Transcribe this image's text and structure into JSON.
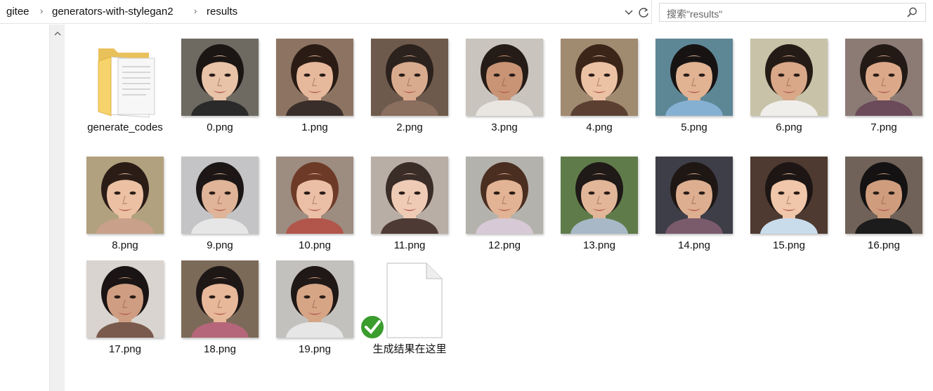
{
  "address_bar": {
    "crumbs": [
      "gitee",
      "generators-with-stylegan2",
      "results"
    ]
  },
  "search": {
    "placeholder": "搜索\"results\""
  },
  "files": [
    {
      "name": "generate_codes",
      "type": "folder"
    },
    {
      "name": "0.png",
      "type": "image",
      "bg": "#6e6a62",
      "skin": "#e8c3a8",
      "hair": "#1b1514",
      "cloth": "#2a2a2a"
    },
    {
      "name": "1.png",
      "type": "image",
      "bg": "#8d7462",
      "skin": "#e6b89c",
      "hair": "#2a1c15",
      "cloth": "#3a2e2a"
    },
    {
      "name": "2.png",
      "type": "image",
      "bg": "#6e5a4c",
      "skin": "#d9ab8e",
      "hair": "#2c221d",
      "cloth": "#8a6e5e"
    },
    {
      "name": "3.png",
      "type": "image",
      "bg": "#c9c4be",
      "skin": "#c99476",
      "hair": "#261c17",
      "cloth": "#e9e6e2"
    },
    {
      "name": "4.png",
      "type": "image",
      "bg": "#a08a70",
      "skin": "#ecc2a5",
      "hair": "#3b2519",
      "cloth": "#5b4032"
    },
    {
      "name": "5.png",
      "type": "image",
      "bg": "#5e8796",
      "skin": "#e1b393",
      "hair": "#171313",
      "cloth": "#86b0d2"
    },
    {
      "name": "6.png",
      "type": "image",
      "bg": "#c8c2a8",
      "skin": "#d9a888",
      "hair": "#251b16",
      "cloth": "#f0eeea"
    },
    {
      "name": "7.png",
      "type": "image",
      "bg": "#8b7b74",
      "skin": "#dba98a",
      "hair": "#231a16",
      "cloth": "#6b4a5a"
    },
    {
      "name": "8.png",
      "type": "image",
      "bg": "#b2a17e",
      "skin": "#ecc1a3",
      "hair": "#2b1d16",
      "cloth": "#c9a08a"
    },
    {
      "name": "9.png",
      "type": "image",
      "bg": "#c4c4c6",
      "skin": "#e0b498",
      "hair": "#1c1716",
      "cloth": "#e6e6e6"
    },
    {
      "name": "10.png",
      "type": "image",
      "bg": "#9d8c80",
      "skin": "#ebbfa6",
      "hair": "#6e3a28",
      "cloth": "#b2554a"
    },
    {
      "name": "11.png",
      "type": "image",
      "bg": "#b8aea6",
      "skin": "#efcbb5",
      "hair": "#3a2c27",
      "cloth": "#4e3a34"
    },
    {
      "name": "12.png",
      "type": "image",
      "bg": "#b4b2ac",
      "skin": "#e2b394",
      "hair": "#4a2e20",
      "cloth": "#d7c9d5"
    },
    {
      "name": "13.png",
      "type": "image",
      "bg": "#5f7b4a",
      "skin": "#e2b699",
      "hair": "#1f1917",
      "cloth": "#a9b8c6"
    },
    {
      "name": "14.png",
      "type": "image",
      "bg": "#3e3e48",
      "skin": "#ddae90",
      "hair": "#1e1714",
      "cloth": "#7a5b6c"
    },
    {
      "name": "15.png",
      "type": "image",
      "bg": "#4e3a30",
      "skin": "#f0c7aa",
      "hair": "#1d1614",
      "cloth": "#c8dcec"
    },
    {
      "name": "16.png",
      "type": "image",
      "bg": "#706258",
      "skin": "#cf9d7e",
      "hair": "#141212",
      "cloth": "#1c1c1c"
    },
    {
      "name": "17.png",
      "type": "image",
      "bg": "#d9d4cf",
      "skin": "#cf9e82",
      "hair": "#1a1514",
      "cloth": "#7a5a4c"
    },
    {
      "name": "18.png",
      "type": "image",
      "bg": "#7c6a58",
      "skin": "#e8b89a",
      "hair": "#1d1716",
      "cloth": "#b5667a"
    },
    {
      "name": "19.png",
      "type": "image",
      "bg": "#c3c1bd",
      "skin": "#d6a586",
      "hair": "#201816",
      "cloth": "#e6e6e6"
    },
    {
      "name": "生成结果在这里",
      "type": "document"
    }
  ]
}
